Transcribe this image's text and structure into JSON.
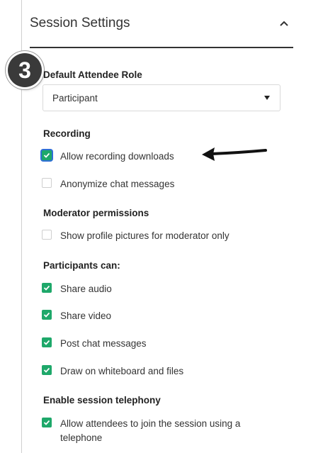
{
  "header": {
    "title": "Session Settings"
  },
  "step_badge": "3",
  "default_role": {
    "label": "Default Attendee Role",
    "selected": "Participant"
  },
  "recording": {
    "label": "Recording",
    "options": [
      {
        "label": "Allow recording downloads",
        "checked": true
      },
      {
        "label": "Anonymize chat messages",
        "checked": false
      }
    ]
  },
  "moderator": {
    "label": "Moderator permissions",
    "options": [
      {
        "label": "Show profile pictures for moderator only",
        "checked": false
      }
    ]
  },
  "participants": {
    "label": "Participants can:",
    "options": [
      {
        "label": "Share audio",
        "checked": true
      },
      {
        "label": "Share video",
        "checked": true
      },
      {
        "label": "Post chat messages",
        "checked": true
      },
      {
        "label": "Draw on whiteboard and files",
        "checked": true
      }
    ]
  },
  "telephony": {
    "label": "Enable session telephony",
    "options": [
      {
        "label": "Allow attendees to join the session using a telephone",
        "checked": true
      }
    ]
  },
  "colors": {
    "checkbox_on": "#1ea86a",
    "focus_ring": "#2f6fd6"
  }
}
